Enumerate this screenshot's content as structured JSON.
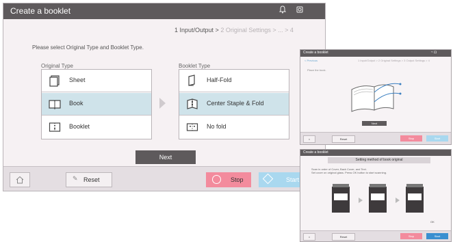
{
  "main": {
    "title": "Create a booklet",
    "steps": {
      "current": "1 Input/Output",
      "sep1": " > ",
      "step2": "2 Original Settings",
      "sep2": " > ... > 4"
    },
    "instruction": "Please select Original Type and Booklet Type.",
    "original_type": {
      "label": "Original Type",
      "options": [
        {
          "label": "Sheet",
          "icon": "sheet-icon",
          "selected": false
        },
        {
          "label": "Book",
          "icon": "book-icon",
          "selected": true
        },
        {
          "label": "Booklet",
          "icon": "booklet-icon",
          "selected": false
        }
      ]
    },
    "booklet_type": {
      "label": "Booklet Type",
      "options": [
        {
          "label": "Half-Fold",
          "icon": "half-fold-icon",
          "selected": false
        },
        {
          "label": "Center Staple & Fold",
          "icon": "center-staple-icon",
          "selected": true
        },
        {
          "label": "No fold",
          "icon": "no-fold-icon",
          "selected": false
        }
      ]
    },
    "next_label": "Next",
    "bottom": {
      "reset_label": "Reset",
      "stop_label": "Stop",
      "start_label": "Start"
    }
  },
  "preview1": {
    "title": "Create a booklet",
    "nav": "< Previous",
    "steps": "1 Input/Output > 2 Original Settings > 3 Output Settings > 4",
    "instruction": "Place the book.",
    "next_label": "Next",
    "reset_label": "Reset",
    "stop_label": "Stop",
    "start_label": "Start"
  },
  "preview2": {
    "title": "Create a booklet",
    "heading": "Setting method of book original",
    "text_line1": "Scan in order of Cover, Back Cover, and Text.",
    "text_line2": "Set cover on original glass. Press OK button to start scanning.",
    "ok_label": "OK",
    "reset_label": "Reset",
    "stop_label": "Stop",
    "start_label": "Start"
  },
  "colors": {
    "titlebar": "#5e5a5c",
    "selected_row": "#cfe3ea",
    "stop": "#f38b9d",
    "start": "#a9d8ef",
    "panel_bg": "#f6f1f3"
  }
}
